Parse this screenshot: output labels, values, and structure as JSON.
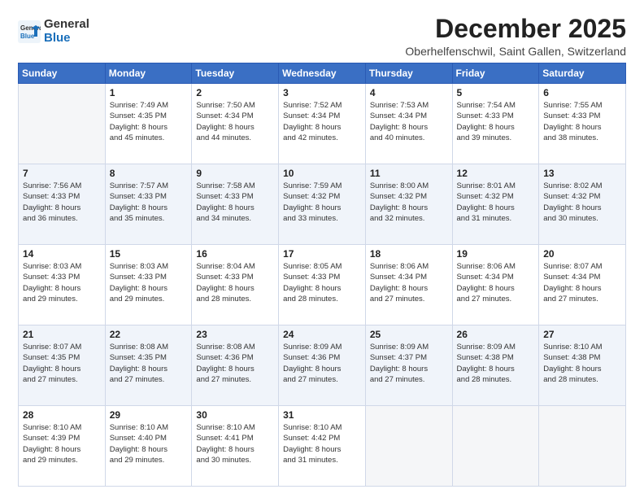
{
  "logo": {
    "text_general": "General",
    "text_blue": "Blue"
  },
  "title": "December 2025",
  "subtitle": "Oberhelfenschwil, Saint Gallen, Switzerland",
  "weekdays": [
    "Sunday",
    "Monday",
    "Tuesday",
    "Wednesday",
    "Thursday",
    "Friday",
    "Saturday"
  ],
  "weeks": [
    [
      {
        "day": "",
        "empty": true
      },
      {
        "day": "1",
        "sunrise": "7:49 AM",
        "sunset": "4:35 PM",
        "daylight": "8 hours and 45 minutes."
      },
      {
        "day": "2",
        "sunrise": "7:50 AM",
        "sunset": "4:34 PM",
        "daylight": "8 hours and 44 minutes."
      },
      {
        "day": "3",
        "sunrise": "7:52 AM",
        "sunset": "4:34 PM",
        "daylight": "8 hours and 42 minutes."
      },
      {
        "day": "4",
        "sunrise": "7:53 AM",
        "sunset": "4:34 PM",
        "daylight": "8 hours and 40 minutes."
      },
      {
        "day": "5",
        "sunrise": "7:54 AM",
        "sunset": "4:33 PM",
        "daylight": "8 hours and 39 minutes."
      },
      {
        "day": "6",
        "sunrise": "7:55 AM",
        "sunset": "4:33 PM",
        "daylight": "8 hours and 38 minutes."
      }
    ],
    [
      {
        "day": "7",
        "sunrise": "7:56 AM",
        "sunset": "4:33 PM",
        "daylight": "8 hours and 36 minutes."
      },
      {
        "day": "8",
        "sunrise": "7:57 AM",
        "sunset": "4:33 PM",
        "daylight": "8 hours and 35 minutes."
      },
      {
        "day": "9",
        "sunrise": "7:58 AM",
        "sunset": "4:33 PM",
        "daylight": "8 hours and 34 minutes."
      },
      {
        "day": "10",
        "sunrise": "7:59 AM",
        "sunset": "4:32 PM",
        "daylight": "8 hours and 33 minutes."
      },
      {
        "day": "11",
        "sunrise": "8:00 AM",
        "sunset": "4:32 PM",
        "daylight": "8 hours and 32 minutes."
      },
      {
        "day": "12",
        "sunrise": "8:01 AM",
        "sunset": "4:32 PM",
        "daylight": "8 hours and 31 minutes."
      },
      {
        "day": "13",
        "sunrise": "8:02 AM",
        "sunset": "4:32 PM",
        "daylight": "8 hours and 30 minutes."
      }
    ],
    [
      {
        "day": "14",
        "sunrise": "8:03 AM",
        "sunset": "4:33 PM",
        "daylight": "8 hours and 29 minutes."
      },
      {
        "day": "15",
        "sunrise": "8:03 AM",
        "sunset": "4:33 PM",
        "daylight": "8 hours and 29 minutes."
      },
      {
        "day": "16",
        "sunrise": "8:04 AM",
        "sunset": "4:33 PM",
        "daylight": "8 hours and 28 minutes."
      },
      {
        "day": "17",
        "sunrise": "8:05 AM",
        "sunset": "4:33 PM",
        "daylight": "8 hours and 28 minutes."
      },
      {
        "day": "18",
        "sunrise": "8:06 AM",
        "sunset": "4:34 PM",
        "daylight": "8 hours and 27 minutes."
      },
      {
        "day": "19",
        "sunrise": "8:06 AM",
        "sunset": "4:34 PM",
        "daylight": "8 hours and 27 minutes."
      },
      {
        "day": "20",
        "sunrise": "8:07 AM",
        "sunset": "4:34 PM",
        "daylight": "8 hours and 27 minutes."
      }
    ],
    [
      {
        "day": "21",
        "sunrise": "8:07 AM",
        "sunset": "4:35 PM",
        "daylight": "8 hours and 27 minutes."
      },
      {
        "day": "22",
        "sunrise": "8:08 AM",
        "sunset": "4:35 PM",
        "daylight": "8 hours and 27 minutes."
      },
      {
        "day": "23",
        "sunrise": "8:08 AM",
        "sunset": "4:36 PM",
        "daylight": "8 hours and 27 minutes."
      },
      {
        "day": "24",
        "sunrise": "8:09 AM",
        "sunset": "4:36 PM",
        "daylight": "8 hours and 27 minutes."
      },
      {
        "day": "25",
        "sunrise": "8:09 AM",
        "sunset": "4:37 PM",
        "daylight": "8 hours and 27 minutes."
      },
      {
        "day": "26",
        "sunrise": "8:09 AM",
        "sunset": "4:38 PM",
        "daylight": "8 hours and 28 minutes."
      },
      {
        "day": "27",
        "sunrise": "8:10 AM",
        "sunset": "4:38 PM",
        "daylight": "8 hours and 28 minutes."
      }
    ],
    [
      {
        "day": "28",
        "sunrise": "8:10 AM",
        "sunset": "4:39 PM",
        "daylight": "8 hours and 29 minutes."
      },
      {
        "day": "29",
        "sunrise": "8:10 AM",
        "sunset": "4:40 PM",
        "daylight": "8 hours and 29 minutes."
      },
      {
        "day": "30",
        "sunrise": "8:10 AM",
        "sunset": "4:41 PM",
        "daylight": "8 hours and 30 minutes."
      },
      {
        "day": "31",
        "sunrise": "8:10 AM",
        "sunset": "4:42 PM",
        "daylight": "8 hours and 31 minutes."
      },
      {
        "day": "",
        "empty": true
      },
      {
        "day": "",
        "empty": true
      },
      {
        "day": "",
        "empty": true
      }
    ]
  ]
}
